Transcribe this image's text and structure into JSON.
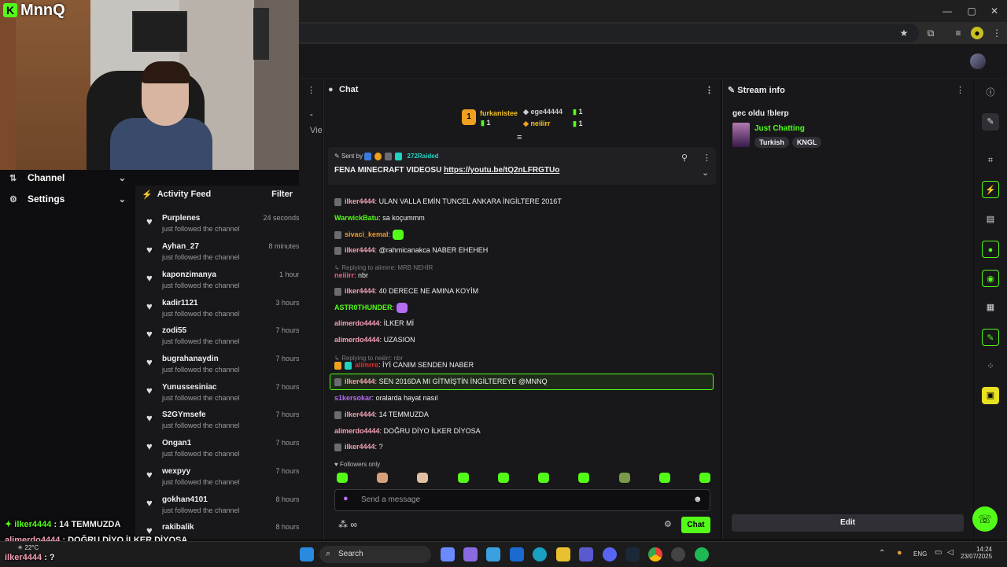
{
  "colors": {
    "accent": "#53fc18",
    "bg": "#0e0e10",
    "panel": "#18181b"
  },
  "stream_logo": {
    "text": "MnnQ"
  },
  "weather": {
    "temp": "22°C"
  },
  "nav": {
    "channel": "Channel",
    "settings": "Settings"
  },
  "activity_feed": {
    "title": "Activity Feed",
    "filter": "Filter",
    "items": [
      {
        "name": "Purplenes",
        "action": "just followed the channel",
        "time": "24 seconds ago"
      },
      {
        "name": "Ayhan_27",
        "action": "just followed the channel",
        "time": "8 minutes ago"
      },
      {
        "name": "kaponzimanya",
        "action": "just followed the channel",
        "time": "1 hour ago"
      },
      {
        "name": "kadir1121",
        "action": "just followed the channel",
        "time": "3 hours ago"
      },
      {
        "name": "zodi55",
        "action": "just followed the channel",
        "time": "7 hours ago"
      },
      {
        "name": "bugrahanaydin",
        "action": "just followed the channel",
        "time": "7 hours ago"
      },
      {
        "name": "Yunussesiniac",
        "action": "just followed the channel",
        "time": "7 hours ago"
      },
      {
        "name": "S2GYmsefe",
        "action": "just followed the channel",
        "time": "7 hours ago"
      },
      {
        "name": "Ongan1",
        "action": "just followed the channel",
        "time": "7 hours ago"
      },
      {
        "name": "wexpyy",
        "action": "just followed the channel",
        "time": "7 hours ago"
      },
      {
        "name": "gokhan4101",
        "action": "just followed the channel",
        "time": "8 hours ago"
      },
      {
        "name": "rakibalik",
        "action": "",
        "time": "8 hours ago"
      }
    ]
  },
  "mid": {
    "dash": "-",
    "view": "Vie"
  },
  "chat": {
    "title": "Chat",
    "top_gifters": [
      {
        "rank": "1",
        "name": "furkanistee",
        "count": "1"
      },
      {
        "name": "ege44444",
        "count": "1"
      },
      {
        "name": "neiiirr",
        "count": "1"
      }
    ],
    "pinned": {
      "sent_by": "Sent by",
      "raid_name": "272Raided",
      "text": "FENA MINECRAFT VIDEOSU",
      "link": "https://youtu.be/tQ2nLFRGTUo"
    },
    "messages": [
      {
        "user": "ilker4444",
        "text": "ULAN VALLA EMİN TUNCEL ANKARA İNGİLTERE 2016T",
        "color": "#f2a0b4"
      },
      {
        "user": "WarwickBatu",
        "text": "sa koçummm",
        "color": "#53fc18"
      },
      {
        "user": "sivaci_kemal",
        "text": "",
        "color": "#f39a2a"
      },
      {
        "user": "ilker4444",
        "text": "@rahmicanakca NABER EHEHEH",
        "color": "#f2a0b4"
      },
      {
        "reply": "Replying to alimrre: MRB NEHİR"
      },
      {
        "user": "neiiirr",
        "text": "nbr",
        "color": "#f25a7a"
      },
      {
        "user": "ilker4444",
        "text": "40 DERECE NE AMINA KOYİM",
        "color": "#f2a0b4"
      },
      {
        "user": "ASTR0THUNDER",
        "text": "",
        "color": "#53fc18"
      },
      {
        "user": "alimerdo4444",
        "text": "İLKER Mİ",
        "color": "#f2a0b4"
      },
      {
        "user": "alimerdo4444",
        "text": "UZASION",
        "color": "#f2a0b4"
      },
      {
        "reply": "Replying to neiiirr: nbr"
      },
      {
        "user": "alimrre",
        "text": "İYİ CANIM SENDEN NABER",
        "color": "#e0302a"
      },
      {
        "user": "ilker4444",
        "text": "SEN 2016DA MI GİTMİŞTİN İNGİLTEREYE @MNNQ",
        "color": "#f2a0b4"
      },
      {
        "user": "s1kersokar",
        "text": "oralarda hayat nasıl",
        "color": "#b56cf0"
      },
      {
        "user": "ilker4444",
        "text": "14 TEMMUZDA",
        "color": "#f2a0b4"
      },
      {
        "user": "alimerdo4444",
        "text": "DOĞRU DİYO İLKER DİYOSA",
        "color": "#f2a0b4"
      },
      {
        "user": "ilker4444",
        "text": "?",
        "color": "#f2a0b4"
      }
    ],
    "followers_only": "Followers only",
    "input_placeholder": "Send a message",
    "send_label": "Chat"
  },
  "stream_info": {
    "title": "Stream info",
    "stream_title": "gec oldu !blerp",
    "category": "Just Chatting",
    "tags": [
      "Turkish",
      "KNGL"
    ],
    "edit_label": "Edit"
  },
  "overlay_chat": [
    {
      "user": "ilker4444",
      "text": "14 TEMMUZDA"
    },
    {
      "user": "alimerdo4444",
      "text": "DOĞRU DİYO İLKER DİYOSA"
    },
    {
      "user": "ilker4444",
      "text": "?"
    }
  ],
  "taskbar": {
    "search": "Search",
    "lang": "ENG",
    "time": "14:24",
    "date": "23/07/2025"
  }
}
